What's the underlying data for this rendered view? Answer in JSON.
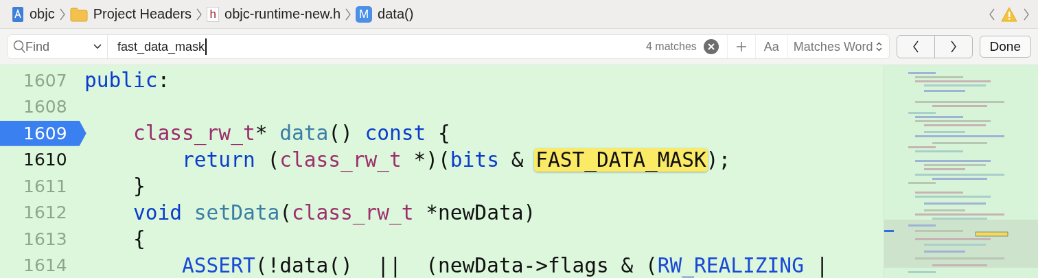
{
  "breadcrumb": [
    {
      "label": "objc",
      "kind": "project"
    },
    {
      "label": "Project Headers",
      "kind": "folder"
    },
    {
      "label": "objc-runtime-new.h",
      "kind": "header",
      "badge": "h"
    },
    {
      "label": "data()",
      "kind": "method",
      "badge": "M"
    }
  ],
  "find": {
    "mode": "Find",
    "query": "fast_data_mask",
    "count": "4 matches",
    "options": "Aa",
    "match_style": "Matches Word",
    "done": "Done"
  },
  "lines": [
    {
      "number": "1607",
      "current": false,
      "breakpoint": false,
      "tokens": [
        {
          "text": "public",
          "kind": "kw"
        },
        {
          "text": ":",
          "kind": "plain"
        }
      ]
    },
    {
      "number": "1608",
      "current": false,
      "breakpoint": false
    },
    {
      "number": "1609",
      "current": false,
      "breakpoint": true,
      "tokens": [
        {
          "text": "    class_rw_t",
          "kind": "type"
        },
        {
          "text": "* ",
          "kind": "plain"
        },
        {
          "text": "data",
          "kind": "fn"
        },
        {
          "text": "() ",
          "kind": "plain"
        },
        {
          "text": "const",
          "kind": "kw"
        },
        {
          "text": " {",
          "kind": "plain"
        }
      ]
    },
    {
      "number": "1610",
      "current": true,
      "breakpoint": false,
      "tokens": [
        {
          "text": "        return",
          "kind": "kw"
        },
        {
          "text": " (",
          "kind": "plain"
        },
        {
          "text": "class_rw_t",
          "kind": "type"
        },
        {
          "text": " *)(",
          "kind": "plain"
        },
        {
          "text": "bits",
          "kind": "kw"
        },
        {
          "text": " & ",
          "kind": "plain"
        },
        {
          "text": "FAST_DATA_MASK",
          "kind": "match"
        },
        {
          "text": ");",
          "kind": "plain"
        }
      ]
    },
    {
      "number": "1611",
      "current": false,
      "breakpoint": false,
      "tokens": [
        {
          "text": "    }",
          "kind": "plain"
        }
      ]
    },
    {
      "number": "1612",
      "current": false,
      "breakpoint": false,
      "tokens": [
        {
          "text": "    void ",
          "kind": "kw"
        },
        {
          "text": "setData",
          "kind": "fn"
        },
        {
          "text": "(",
          "kind": "plain"
        },
        {
          "text": "class_rw_t",
          "kind": "type"
        },
        {
          "text": " *newData)",
          "kind": "plain"
        }
      ]
    },
    {
      "number": "1613",
      "current": false,
      "breakpoint": false,
      "tokens": [
        {
          "text": "    {",
          "kind": "plain"
        }
      ]
    },
    {
      "number": "1614",
      "current": false,
      "breakpoint": false,
      "tokens": [
        {
          "text": "        ASSERT",
          "kind": "macro"
        },
        {
          "text": "(!data()  ||  (newData->flags & (",
          "kind": "plain"
        },
        {
          "text": "RW_REALIZING",
          "kind": "macro"
        },
        {
          "text": " |",
          "kind": "plain"
        }
      ]
    }
  ]
}
